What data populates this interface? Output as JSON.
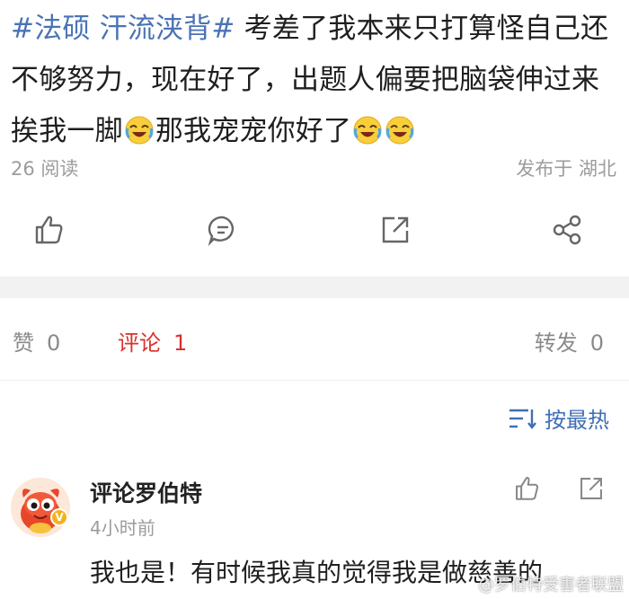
{
  "post": {
    "topic": "#法硕 汗流浃背#",
    "text_1": " 考差了我本来只打算怪自己还不够努力，现在好了，出题人偏要把脑袋伸过来挨我一脚",
    "emoji_name": "laugh-cry-emoji",
    "text_2": "那我宠宠你好了"
  },
  "meta": {
    "reads": "26 阅读",
    "location": "发布于 湖北"
  },
  "action_icons": [
    "like-icon",
    "comment-icon",
    "share-icon",
    "forward-icon"
  ],
  "tabs": {
    "likes_label": "赞",
    "likes_count": "0",
    "comments_label": "评论",
    "comments_count": "1",
    "reposts_label": "转发",
    "reposts_count": "0"
  },
  "sort": {
    "label": "按最热",
    "icon": "sort-icon"
  },
  "comment": {
    "author": "评论罗伯特",
    "time": "4小时前",
    "text": "我也是！有时候我真的觉得我是做慈善的",
    "badge": "V"
  },
  "watermark": "@罗伯特受害者联盟",
  "colors": {
    "topic_link": "#4a73b5",
    "active_tab": "#d9302b",
    "muted": "#9c9c9c",
    "divider_band": "#f2f2f2"
  }
}
